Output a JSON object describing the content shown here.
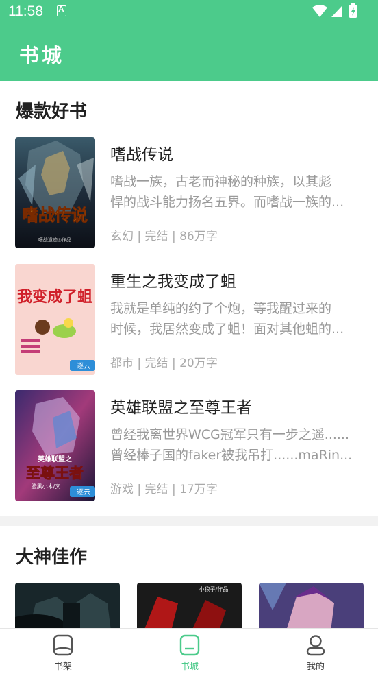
{
  "status_bar": {
    "time": "11:58"
  },
  "app_bar": {
    "title": "书城"
  },
  "sections": {
    "hot": {
      "title": "爆款好书"
    },
    "master": {
      "title": "大神佳作"
    }
  },
  "books": [
    {
      "title": "嗜战传说",
      "desc_line1": "嗜战一族，古老而神秘的种族，以其彪",
      "desc_line2": "悍的战斗能力扬名五界。而嗜战一族的...",
      "meta": "玄幻 | 完结 | 86万字",
      "cover_text": "嗜战传说",
      "cover_sub": "嗜战道迹◎作品"
    },
    {
      "title": "重生之我变成了蛆",
      "desc_line1": "我就是单纯的约了个炮，等我醒过来的",
      "desc_line2": "时候，我居然变成了蛆！面对其他蛆的...",
      "meta": "都市 | 完结 | 20万字",
      "cover_text": "我变成了蛆",
      "cover_badge": "逐云"
    },
    {
      "title": "英雄联盟之至尊王者",
      "desc_line1": "曾经我离世界WCG冠军只有一步之遥......",
      "desc_line2": "曾经棒子国的faker被我吊打......maRin...",
      "meta": "游戏 | 完结 | 17万字",
      "cover_text": "至尊王者",
      "cover_top": "英雄联盟之",
      "cover_sub": "脸黑小木/文",
      "cover_badge": "逐云"
    }
  ],
  "thumbs": [
    {
      "caption": ""
    },
    {
      "caption": "小狼子/作品"
    },
    {
      "caption": ""
    }
  ],
  "tabs": [
    {
      "label": "书架",
      "icon": "bookshelf-icon"
    },
    {
      "label": "书城",
      "icon": "bookstore-icon"
    },
    {
      "label": "我的",
      "icon": "profile-icon"
    }
  ],
  "colors": {
    "accent": "#4ccb8b"
  }
}
